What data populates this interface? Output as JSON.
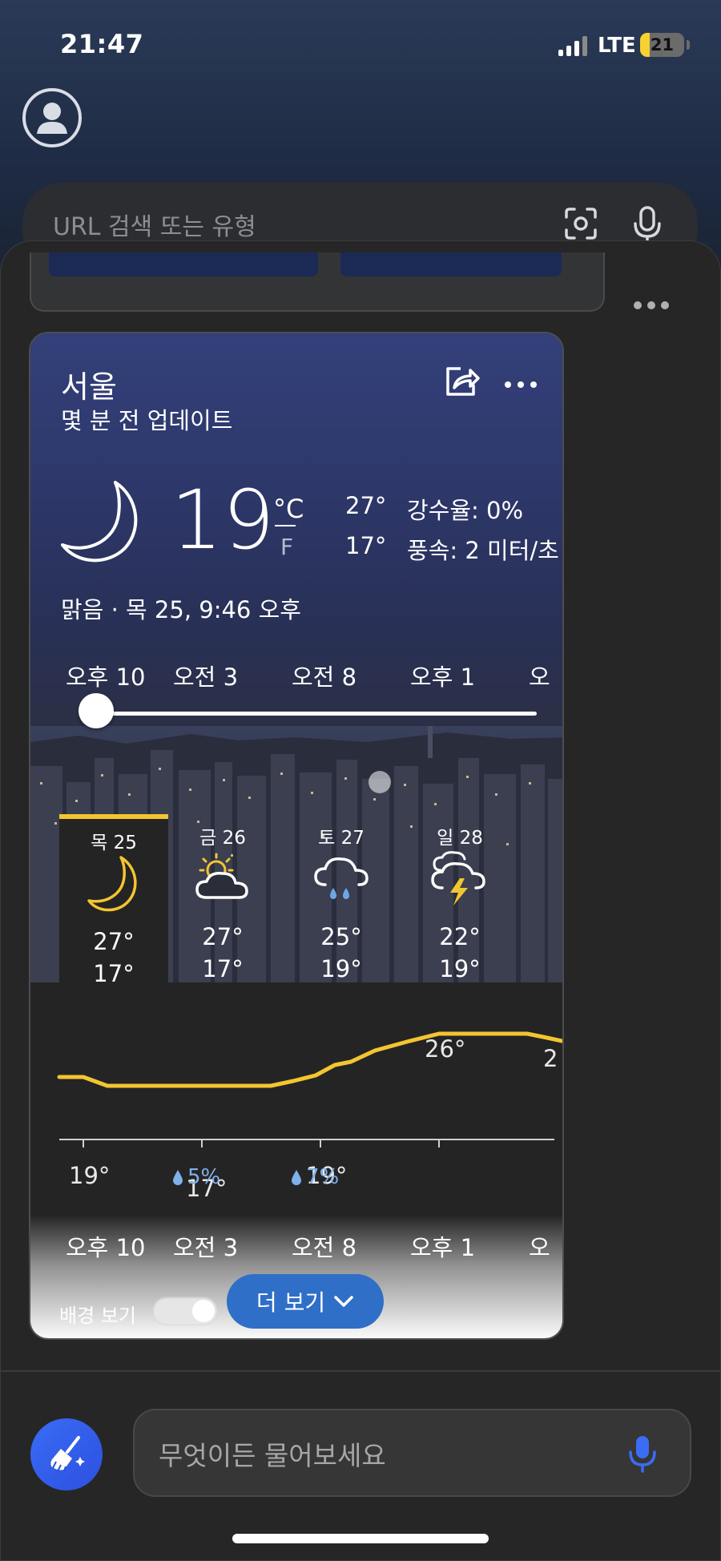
{
  "status_bar": {
    "time": "21:47",
    "network": "LTE",
    "battery": "21",
    "battery_level": 0.21
  },
  "search": {
    "placeholder": "URL 검색 또는 유형"
  },
  "weather": {
    "city": "서울",
    "updated": "몇 분 전 업데이트",
    "temperature": "19",
    "unit_c": "°C",
    "unit_f": "F",
    "high": "27°",
    "low": "17°",
    "precip": "강수율: 0%",
    "wind": "풍속: 2 미터/초",
    "condition": "맑음 · 목 25, 9:46 오후",
    "hour_labels": [
      "오후 10",
      "오전 3",
      "오전 8",
      "오후 1",
      "오"
    ],
    "days": [
      {
        "label": "목 25",
        "high": "27°",
        "low": "17°",
        "icon": "moon-icon",
        "active": true
      },
      {
        "label": "금 26",
        "high": "27°",
        "low": "17°",
        "icon": "partly-sunny-icon",
        "active": false
      },
      {
        "label": "토 27",
        "high": "25°",
        "low": "19°",
        "icon": "rain-cloud-icon",
        "active": false
      },
      {
        "label": "일 28",
        "high": "22°",
        "low": "19°",
        "icon": "thunderstorm-icon",
        "active": false
      }
    ],
    "graph_temps": [
      "19°",
      "17°",
      "19°",
      "26°",
      "2"
    ],
    "graph_rain": [
      "5%",
      "7%"
    ],
    "background_toggle_label": "배경 보기",
    "more_button": "더 보기"
  },
  "assistant": {
    "placeholder": "무엇이든 물어보세요"
  },
  "colors": {
    "accent_yellow": "#f3c530",
    "accent_blue": "#2f6fc7",
    "fab_blue": "#3a6cf4",
    "rain_blue": "#7fb0ea"
  }
}
